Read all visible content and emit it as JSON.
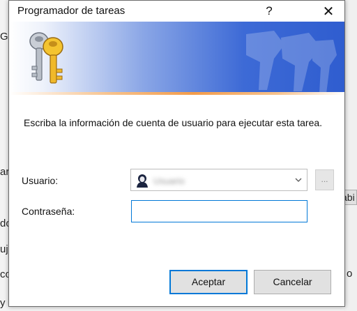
{
  "window": {
    "title": "Programador de tareas",
    "help_label": "?",
    "close_label": "✕"
  },
  "background": {
    "fragments": [
      "G",
      "ar",
      "do",
      "uj",
      "co",
      "y",
      "o",
      "abi"
    ]
  },
  "banner": {
    "icon": "keys-icon",
    "colors": {
      "blue": "#2f5dcf",
      "orange": "#f39c4a"
    }
  },
  "message": "Escriba la información de cuenta de usuario para ejecutar esta tarea.",
  "form": {
    "user_label": "Usuario:",
    "user_value": "Usuario",
    "browse_label": "...",
    "password_label": "Contraseña:",
    "password_value": ""
  },
  "buttons": {
    "accept": "Aceptar",
    "cancel": "Cancelar"
  },
  "colors": {
    "focus": "#0078d7"
  }
}
